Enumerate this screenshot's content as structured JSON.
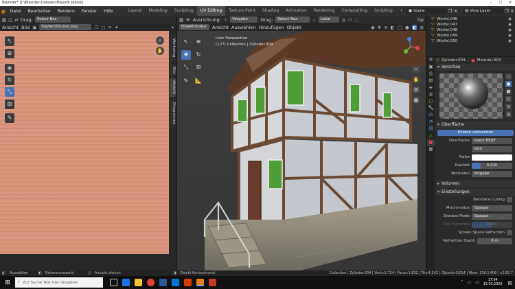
{
  "window": {
    "title": "Blender* [I:\\Blender-Dateien\\Hausfk.blend]"
  },
  "menu": [
    "Datei",
    "Bearbeiten",
    "Rendern",
    "Fenster",
    "Hilfe"
  ],
  "workspaces": [
    "Layout",
    "Modeling",
    "Sculpting",
    "UV Editing",
    "Texture Paint",
    "Shading",
    "Animation",
    "Rendering",
    "Compositing",
    "Scripting"
  ],
  "active_workspace": "UV Editing",
  "scene": {
    "label": "Scene",
    "view_layer": "View Layer"
  },
  "uv_editor": {
    "drag_label": "Drag:",
    "select_mode": "Select Box",
    "view_menu": "Ansicht",
    "image_menu": "Bild",
    "image_name": "Kupfer10Gross.png",
    "side_tabs": [
      "Werkzeug",
      "Bild",
      "Ansicht",
      "Diagramme"
    ],
    "texture_color": "#d9907a"
  },
  "viewport": {
    "orientation_label": "Ausrichtung:",
    "orientation_value": "Vorgabe",
    "drag_label": "Drag:",
    "select_mode": "Select Box",
    "transform_space": "Lokal",
    "mode": "Objektmodus",
    "menus": [
      "Ansicht",
      "Auswählen",
      "Hinzufügen",
      "Objekt"
    ],
    "overlay_line1": "User Perspective",
    "overlay_line2_prefix": "(127) Collection",
    "overlay_line2_object": "Zylinder.004",
    "options_label": "Op"
  },
  "outliner": {
    "items": [
      "Würfel.046",
      "Würfel.047",
      "Würfel.048",
      "Würfel.049",
      "Würfel.050"
    ]
  },
  "properties": {
    "object_name": "Zylinder.004",
    "material_name": "Material.004",
    "preview_label": "Vorschau",
    "surface_label": "Oberfläche",
    "use_nodes_button": "Knoten verwenden",
    "surface_field_label": "Oberfläche",
    "surface_field_value": "Glanz BSDF",
    "distribution_value": "GGX",
    "color_label": "Farbe",
    "roughness_label": "Rauheit",
    "roughness_value": "0.220",
    "normal_label": "Normalen",
    "normal_value": "Vorgabe",
    "volume_label": "Volumen",
    "settings_label": "Einstellungen",
    "backface_label": "Backface Culling",
    "blend_mode_label": "Mischmodus",
    "blend_mode_value": "Opaque",
    "shadow_mode_label": "Shadow Mode",
    "shadow_mode_value": "Opaque",
    "clip_label": "Clip Threshold",
    "clip_value": "0.500",
    "ssr_label": "Screen Space Refraction",
    "refraction_depth_label": "Refraction Depth",
    "refraction_depth_value": "0 m"
  },
  "status_bar": {
    "select": "Auswählen",
    "box_select": "Rahmenauswahl",
    "rotate_view": "Ansicht drehen",
    "context_menu": "Objekt Kontextmenü",
    "stats": "Collection | Zylinder.004 | Verts:2,724 | Faces:1,832 | Tris:4,242 | Objects:0/214 | Mem: 156.1 MiB | v2.82.7"
  },
  "taskbar": {
    "search_placeholder": "Zur Suche Text hier eingeben",
    "time": "17:04",
    "date": "15.03.2020"
  },
  "colors": {
    "accent": "#4772b3",
    "panel": "#303030",
    "copper": "#d9907a"
  }
}
